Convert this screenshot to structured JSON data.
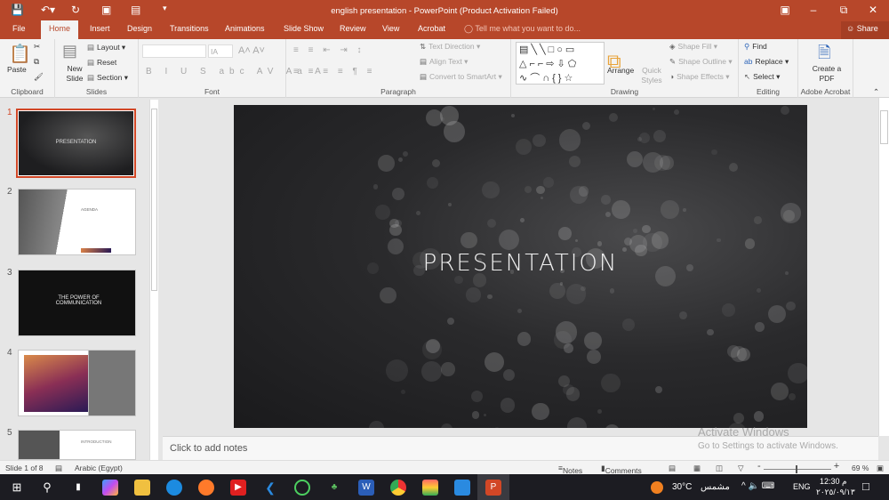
{
  "window": {
    "title": "english presentation - PowerPoint (Product Activation Failed)"
  },
  "tabs": [
    "File",
    "Home",
    "Insert",
    "Design",
    "Transitions",
    "Animations",
    "Slide Show",
    "Review",
    "View",
    "Acrobat"
  ],
  "tell_me": "Tell me what you want to do...",
  "share": "Share",
  "ribbon": {
    "clipboard": {
      "label": "Clipboard",
      "paste": "Paste"
    },
    "slides": {
      "label": "Slides",
      "new_slide": "New Slide",
      "layout": "Layout",
      "reset": "Reset",
      "section": "Section"
    },
    "font": {
      "label": "Font",
      "size": "IA"
    },
    "paragraph": {
      "label": "Paragraph",
      "text_direction": "Text Direction",
      "align_text": "Align Text",
      "convert": "Convert to SmartArt"
    },
    "drawing": {
      "label": "Drawing",
      "arrange": "Arrange",
      "quick_styles": "Quick Styles",
      "shape_fill": "Shape Fill",
      "shape_outline": "Shape Outline",
      "shape_effects": "Shape Effects"
    },
    "editing": {
      "label": "Editing",
      "find": "Find",
      "replace": "Replace",
      "select": "Select"
    },
    "acrobat": {
      "label": "Adobe Acrobat",
      "create_pdf": "Create a PDF"
    }
  },
  "thumbnails": [
    {
      "num": "1",
      "title": "PRESENTATION"
    },
    {
      "num": "2",
      "title": "AGENDA"
    },
    {
      "num": "3",
      "title": "THE POWER OF COMMUNICATION"
    },
    {
      "num": "4",
      "title": ""
    },
    {
      "num": "5",
      "title": "INTRODUCTION"
    }
  ],
  "slide": {
    "title": "PRESENTATION"
  },
  "notes_placeholder": "Click to add notes",
  "watermark": {
    "line1": "Activate Windows",
    "line2": "Go to Settings to activate Windows."
  },
  "status": {
    "slide": "Slide 1 of 8",
    "language": "Arabic (Egypt)",
    "notes": "Notes",
    "comments": "Comments",
    "zoom": "69 %"
  },
  "taskbar": {
    "weather": "30°C",
    "weather_text": "مشمس",
    "lang": "ENG",
    "time": "12:30 م",
    "date": "٢٠٢٥/٠٩/١٣"
  }
}
